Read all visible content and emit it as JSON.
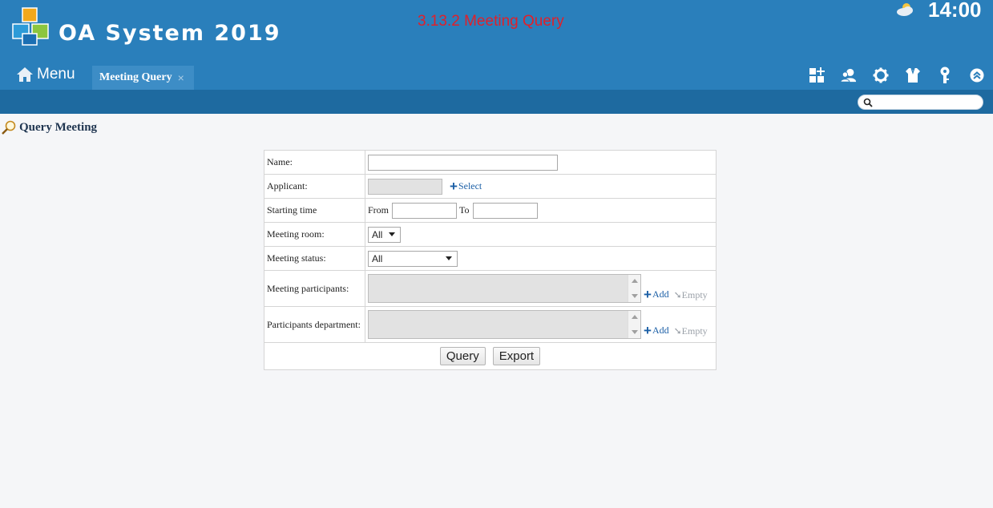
{
  "header": {
    "app_title": "OA System 2019",
    "page_caption": "3.13.2 Meeting Query",
    "clock": "14:00"
  },
  "nav": {
    "menu_label": "Menu",
    "active_tab": "Meeting Query",
    "tab_close": "×"
  },
  "search": {
    "placeholder": ""
  },
  "section": {
    "title": "Query Meeting"
  },
  "form": {
    "name_label": "Name:",
    "applicant_label": "Applicant:",
    "select_link": "Select",
    "starting_time_label": "Starting time",
    "from_label": "From",
    "to_label": "To",
    "meeting_room_label": "Meeting room:",
    "meeting_room_value": "All",
    "meeting_status_label": "Meeting status:",
    "meeting_status_value": "All",
    "participants_label": "Meeting participants:",
    "department_label": "Participants department:",
    "add_link": "Add",
    "empty_link": "Empty",
    "query_button": "Query",
    "export_button": "Export"
  },
  "colors": {
    "header_blue": "#2a7fbb",
    "subbar_blue": "#1e6aa0",
    "caption_red": "#e0202a",
    "link_blue": "#1b5fa6"
  }
}
